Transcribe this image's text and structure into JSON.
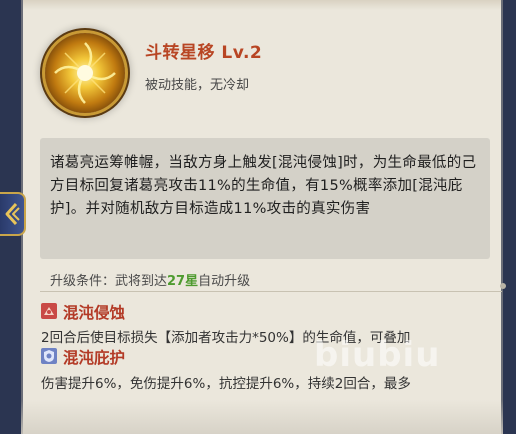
{
  "skill": {
    "name": "斗转星移 Lv.2",
    "type": "被动技能，无冷却",
    "icon": "golden-swirl-icon",
    "description": "诸葛亮运筹帷幄，当敌方身上触发[混沌侵蚀]时，为生命最低的己方目标回复诸葛亮攻击11%的生命值，有15%概率添加[混沌庇护]。并对随机敌方目标造成11%攻击的真实伤害"
  },
  "upgrade": {
    "prefix": "升级条件：武将到达",
    "stars": "27星",
    "suffix": "自动升级"
  },
  "buffs": [
    {
      "icon": "chaos-erosion-icon",
      "name": "混沌侵蚀",
      "description": "2回合后使目标损失【添加者攻击力*50%】的生命值，可叠加"
    },
    {
      "icon": "chaos-shield-icon",
      "name": "混沌庇护",
      "description": "伤害提升6%，免伤提升6%，抗控提升6%，持续2回合，最多"
    }
  ],
  "watermark": "biubiu",
  "colors": {
    "skill_name": "#b84523",
    "star_count": "#4e9b2f",
    "buff_title": "#b33a26",
    "panel_bg": "#ebe7dc"
  }
}
